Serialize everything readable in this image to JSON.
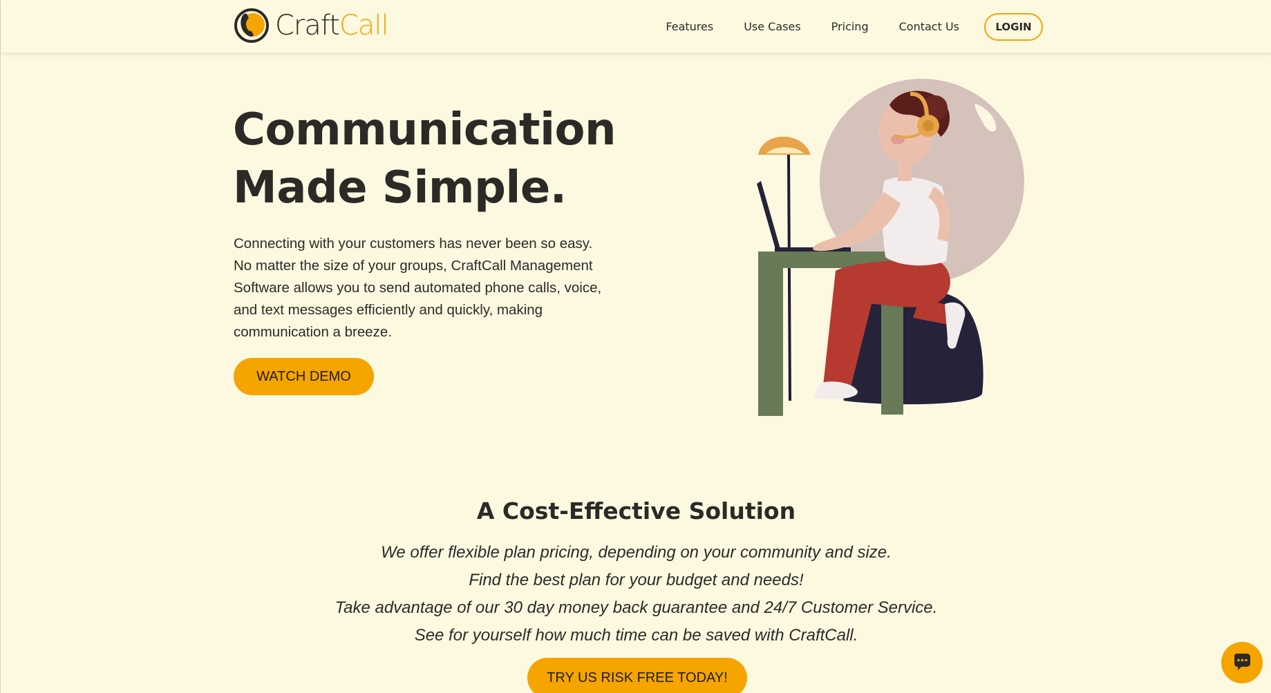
{
  "brand": {
    "name_part1": "Craft",
    "name_part2": "Call",
    "accent_color": "#f5a400"
  },
  "nav": {
    "items": [
      {
        "label": "Features"
      },
      {
        "label": "Use Cases"
      },
      {
        "label": "Pricing"
      },
      {
        "label": "Contact Us"
      }
    ],
    "login_label": "LOGIN"
  },
  "hero": {
    "title_line1": "Communication",
    "title_line2": "Made Simple.",
    "description_lines": [
      "Connecting with your customers has never been so easy.",
      "No matter the size of your groups, CraftCall Management",
      "Software allows you to send automated phone calls, voice,",
      "and text messages efficiently and quickly, making",
      "communication a breeze."
    ],
    "cta_label": "WATCH DEMO",
    "illustration_icon": "person-at-desk-with-headset-illustration"
  },
  "cost_section": {
    "title": "A Cost-Effective Solution",
    "lines": [
      "We offer flexible plan pricing, depending on your community and size.",
      "Find the best plan for your budget and needs!",
      "Take advantage of our 30 day money back guarantee and 24/7 Customer Service.",
      "See for yourself how much time can be saved with CraftCall."
    ],
    "cta_label": "TRY US RISK FREE TODAY!"
  },
  "chat_widget": {
    "icon": "chat-bubble-icon"
  }
}
